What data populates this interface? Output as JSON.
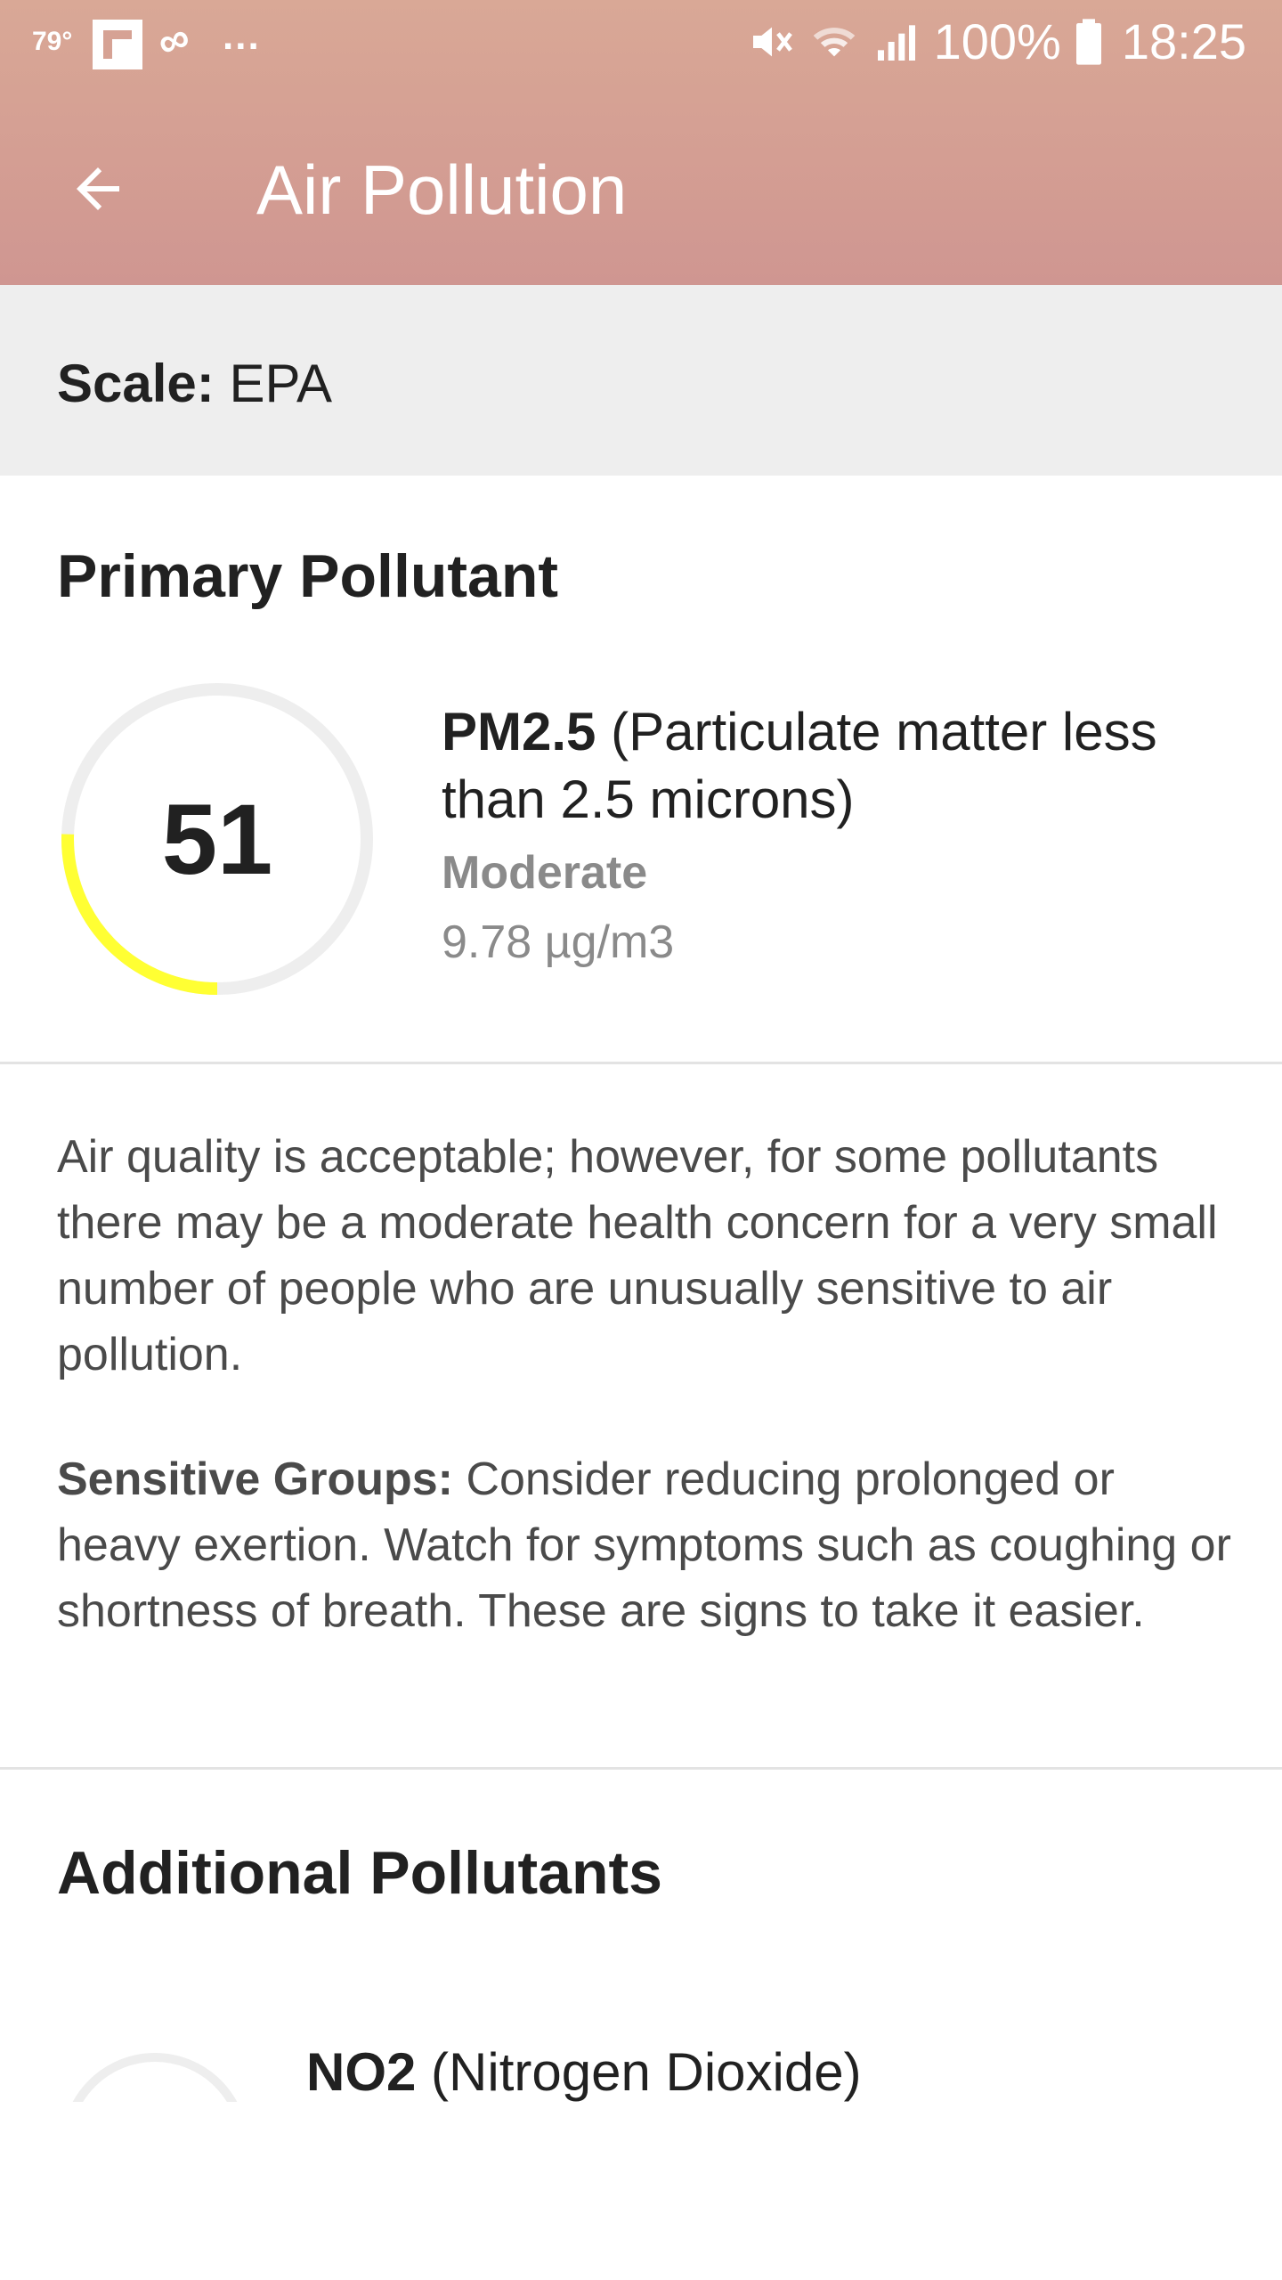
{
  "status_bar": {
    "temperature": "79°",
    "notification_more": "...",
    "battery_percent": "100%",
    "time": "18:25",
    "icons": [
      "flipboard-icon",
      "link-icon",
      "mute-icon",
      "wifi-icon",
      "signal-icon",
      "battery-icon"
    ]
  },
  "toolbar": {
    "back_icon": "arrow-left-icon",
    "title": "Air Pollution"
  },
  "scale": {
    "label": "Scale:",
    "value": "EPA"
  },
  "primary": {
    "section_title": "Primary Pollutant",
    "aqi_value": "51",
    "gauge_fraction": 0.255,
    "gauge_color": "#ffff33",
    "code": "PM2.5",
    "full_name": "(Particulate matter less than 2.5 microns)",
    "level": "Moderate",
    "concentration": "9.78 µg/m3"
  },
  "description": "Air quality is acceptable; however, for some pollutants there may be a moderate health concern for a very small number of people who are unusually sensitive to air pollution.",
  "sensitive": {
    "label": "Sensitive Groups:",
    "text": "Consider reducing prolonged or heavy exertion. Watch for symptoms such as coughing or shortness of breath. These are signs to take it easier."
  },
  "additional": {
    "section_title": "Additional Pollutants",
    "items": [
      {
        "code": "NO2",
        "full_name": "(Nitrogen Dioxide)"
      }
    ]
  },
  "colors": {
    "appbar_top": "#d9a896",
    "appbar_bottom": "#cf9691",
    "scale_strip": "#eeeeee",
    "gauge_track": "#eeeeee",
    "secondary_text": "#8a8a8a"
  }
}
